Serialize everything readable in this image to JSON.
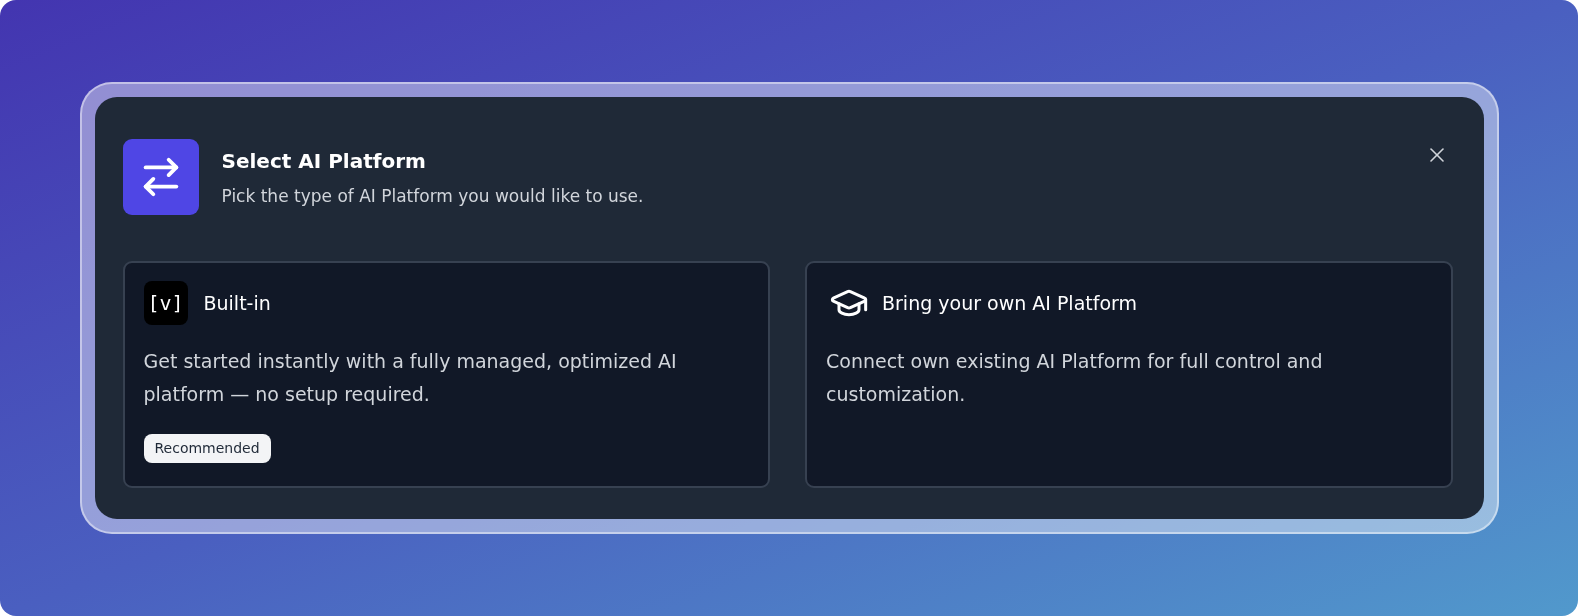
{
  "dialog": {
    "title": "Select AI Platform",
    "subtitle": "Pick the type of AI Platform you would like to use."
  },
  "options": [
    {
      "kind": "builtin",
      "logo_text": "[v]",
      "title": "Built-in",
      "description": "Get started instantly with a fully managed, optimized AI platform — no setup required.",
      "badge": "Recommended"
    },
    {
      "kind": "custom",
      "title": "Bring your own AI Platform",
      "description": "Connect own existing AI Platform for full control and customization."
    }
  ]
}
